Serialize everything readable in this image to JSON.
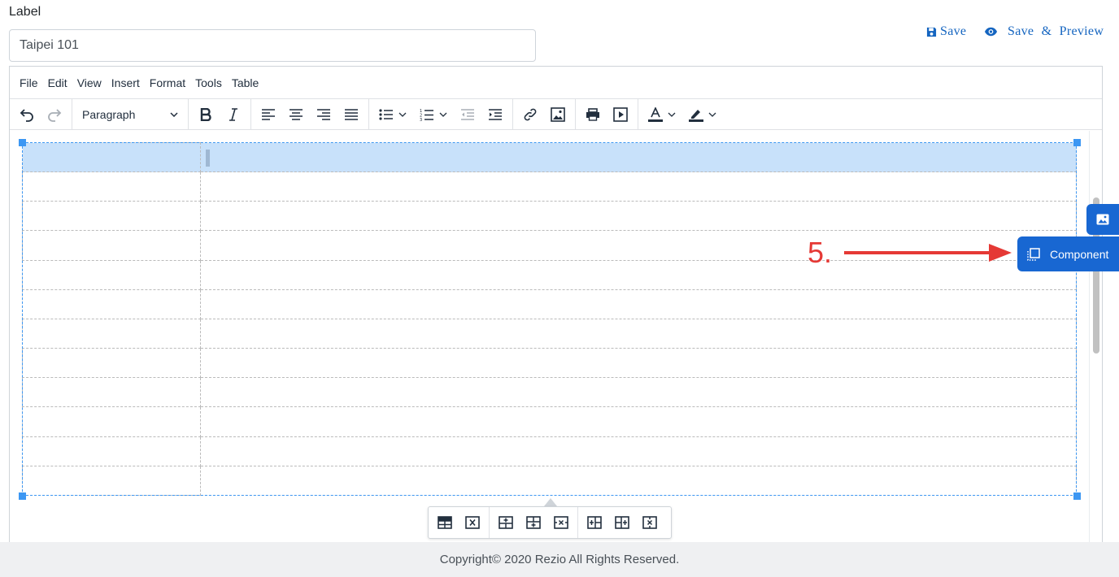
{
  "form": {
    "label": "Label",
    "label_value": "Taipei 101"
  },
  "actions": {
    "save": "Save",
    "save_preview": "Save & Preview"
  },
  "menubar": [
    "File",
    "Edit",
    "View",
    "Insert",
    "Format",
    "Tools",
    "Table"
  ],
  "toolbar": {
    "block_format": "Paragraph",
    "icons": [
      "undo-icon",
      "redo-icon",
      "bold-icon",
      "italic-icon",
      "align-left-icon",
      "align-center-icon",
      "align-right-icon",
      "align-justify-icon",
      "bullet-list-icon",
      "numbered-list-icon",
      "outdent-icon",
      "indent-icon",
      "link-icon",
      "image-icon",
      "print-icon",
      "media-icon",
      "text-color-icon",
      "highlight-color-icon"
    ]
  },
  "table": {
    "rows": 12,
    "columns": 2,
    "selected_row": 1
  },
  "table_toolbar": {
    "icons": [
      "table-properties-icon",
      "delete-table-icon",
      "insert-row-before-icon",
      "insert-row-after-icon",
      "delete-row-icon",
      "insert-column-before-icon",
      "insert-column-after-icon",
      "delete-column-icon"
    ]
  },
  "side_tabs": {
    "component": "Component"
  },
  "annotation": {
    "label": "5.",
    "color": "#e53935"
  },
  "footer": {
    "text": "Copyright© 2020 Rezio All Rights Reserved."
  },
  "colors": {
    "accent": "#1867d2",
    "selection": "#c8e1fa",
    "table_outline": "#3c97f3"
  }
}
